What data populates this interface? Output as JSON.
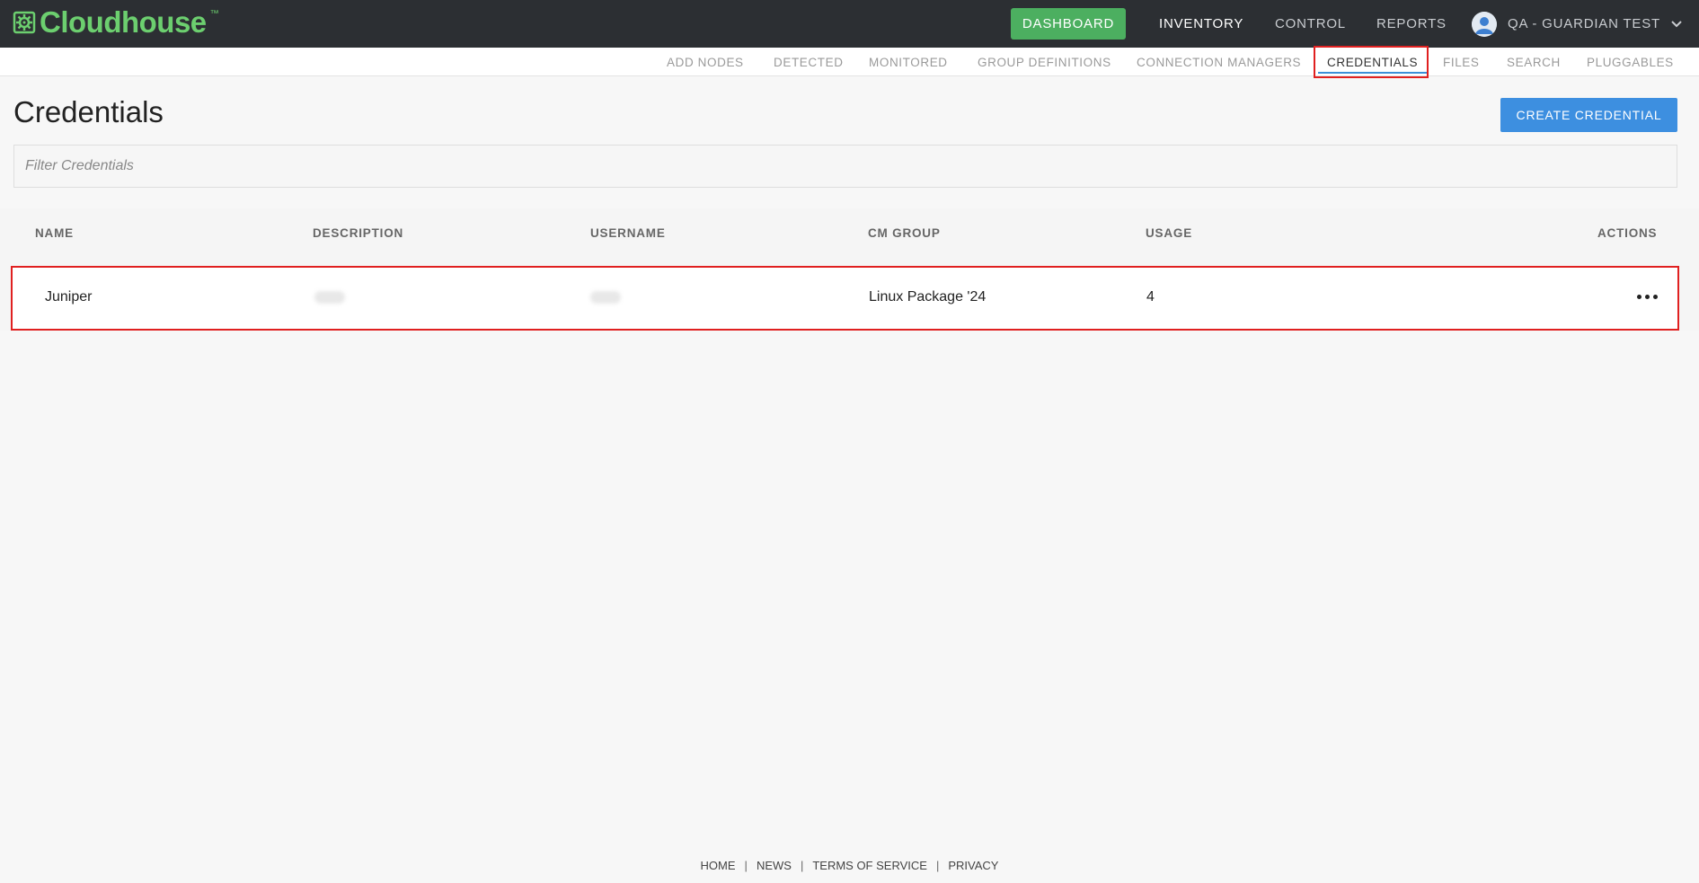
{
  "brand": {
    "name": "Cloudhouse",
    "tm": "™"
  },
  "topnav": {
    "dashboard": "DASHBOARD",
    "inventory": "INVENTORY",
    "control": "CONTROL",
    "reports": "REPORTS",
    "user": "QA - GUARDIAN TEST"
  },
  "subnav": {
    "items": [
      "ADD NODES",
      "DETECTED",
      "MONITORED",
      "GROUP DEFINITIONS",
      "CONNECTION MANAGERS",
      "CREDENTIALS",
      "FILES",
      "SEARCH",
      "PLUGGABLES"
    ],
    "active": "CREDENTIALS"
  },
  "page": {
    "title": "Credentials",
    "create_label": "CREATE CREDENTIAL",
    "filter_placeholder": "Filter Credentials"
  },
  "table": {
    "headers": [
      "NAME",
      "DESCRIPTION",
      "USERNAME",
      "CM GROUP",
      "USAGE",
      "ACTIONS"
    ],
    "rows": [
      {
        "name": "Juniper",
        "cm_group": "Linux Package '24",
        "usage": "4"
      }
    ]
  },
  "footer": {
    "links": [
      "HOME",
      "NEWS",
      "TERMS OF SERVICE",
      "PRIVACY"
    ]
  },
  "colors": {
    "topbar": "#2c2f33",
    "brand_green": "#6ccf6f",
    "dashboard_green": "#4caf60",
    "primary_blue": "#3d8fe0",
    "highlight_red": "#e02020"
  }
}
